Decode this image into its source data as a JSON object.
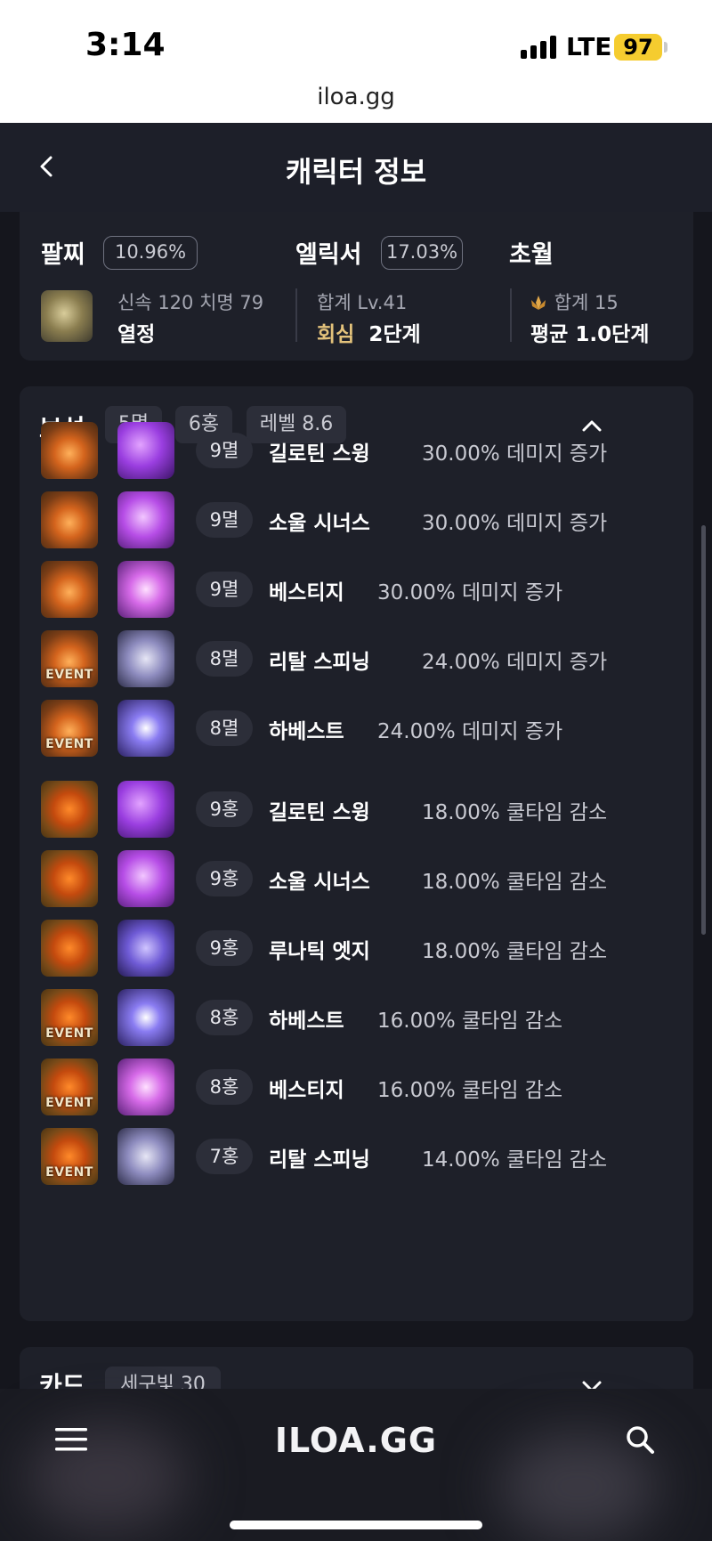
{
  "status_bar": {
    "time": "3:14",
    "network": "LTE",
    "battery": "97",
    "url": "iloa.gg"
  },
  "header": {
    "title": "캐릭터 정보"
  },
  "top_card": {
    "bracelet": {
      "label": "팔찌",
      "percent": "10.96%",
      "stats": "신속 120   치명 79",
      "name": "열정"
    },
    "elixir": {
      "label": "엘릭서",
      "percent": "17.03%",
      "total": "합계 Lv.41",
      "effect_name": "회심",
      "effect_stage": "2단계"
    },
    "transcend": {
      "label": "초월",
      "total": "합계 15",
      "average": "평균 1.0단계"
    }
  },
  "gems": {
    "title": "보석",
    "tags": [
      "5멸",
      "6홍",
      "레벨 8.6"
    ],
    "rows": [
      {
        "level": "9멸",
        "skill": "길로틴 스윙",
        "effect": "30.00% 데미지 증가",
        "type": "myul",
        "event": "",
        "skill_color": "purple"
      },
      {
        "level": "9멸",
        "skill": "소울 시너스",
        "effect": "30.00% 데미지 증가",
        "type": "myul",
        "event": "",
        "skill_color": "violet"
      },
      {
        "level": "9멸",
        "skill": "베스티지",
        "effect": "30.00% 데미지 증가",
        "type": "myul",
        "event": "",
        "skill_color": "pink"
      },
      {
        "level": "8멸",
        "skill": "리탈 스피닝",
        "effect": "24.00% 데미지 증가",
        "type": "myul",
        "event": "EVENT",
        "skill_color": "silver"
      },
      {
        "level": "8멸",
        "skill": "하베스트",
        "effect": "24.00% 데미지 증가",
        "type": "myul",
        "event": "EVENT",
        "skill_color": "blue"
      },
      {
        "level": "9홍",
        "skill": "길로틴 스윙",
        "effect": "18.00% 쿨타임 감소",
        "type": "hong",
        "event": "",
        "skill_color": "purple"
      },
      {
        "level": "9홍",
        "skill": "소울 시너스",
        "effect": "18.00% 쿨타임 감소",
        "type": "hong",
        "event": "",
        "skill_color": "violet"
      },
      {
        "level": "9홍",
        "skill": "루나틱 엣지",
        "effect": "18.00% 쿨타임 감소",
        "type": "hong",
        "event": "",
        "skill_color": "indigo"
      },
      {
        "level": "8홍",
        "skill": "하베스트",
        "effect": "16.00% 쿨타임 감소",
        "type": "hong",
        "event": "EVENT",
        "skill_color": "blue"
      },
      {
        "level": "8홍",
        "skill": "베스티지",
        "effect": "16.00% 쿨타임 감소",
        "type": "hong",
        "event": "EVENT",
        "skill_color": "pink"
      },
      {
        "level": "7홍",
        "skill": "리탈 스피닝",
        "effect": "14.00% 쿨타임 감소",
        "type": "hong",
        "event": "EVENT",
        "skill_color": "silver"
      }
    ]
  },
  "cards_section": {
    "title": "카드",
    "tag": "세구빛 30"
  },
  "bottom_nav": {
    "logo": "ILOA.GG"
  },
  "colors": {
    "background": "#15161d",
    "card": "#1e2029",
    "accent_gold": "#e3c27b",
    "battery": "#f5cc2f"
  }
}
